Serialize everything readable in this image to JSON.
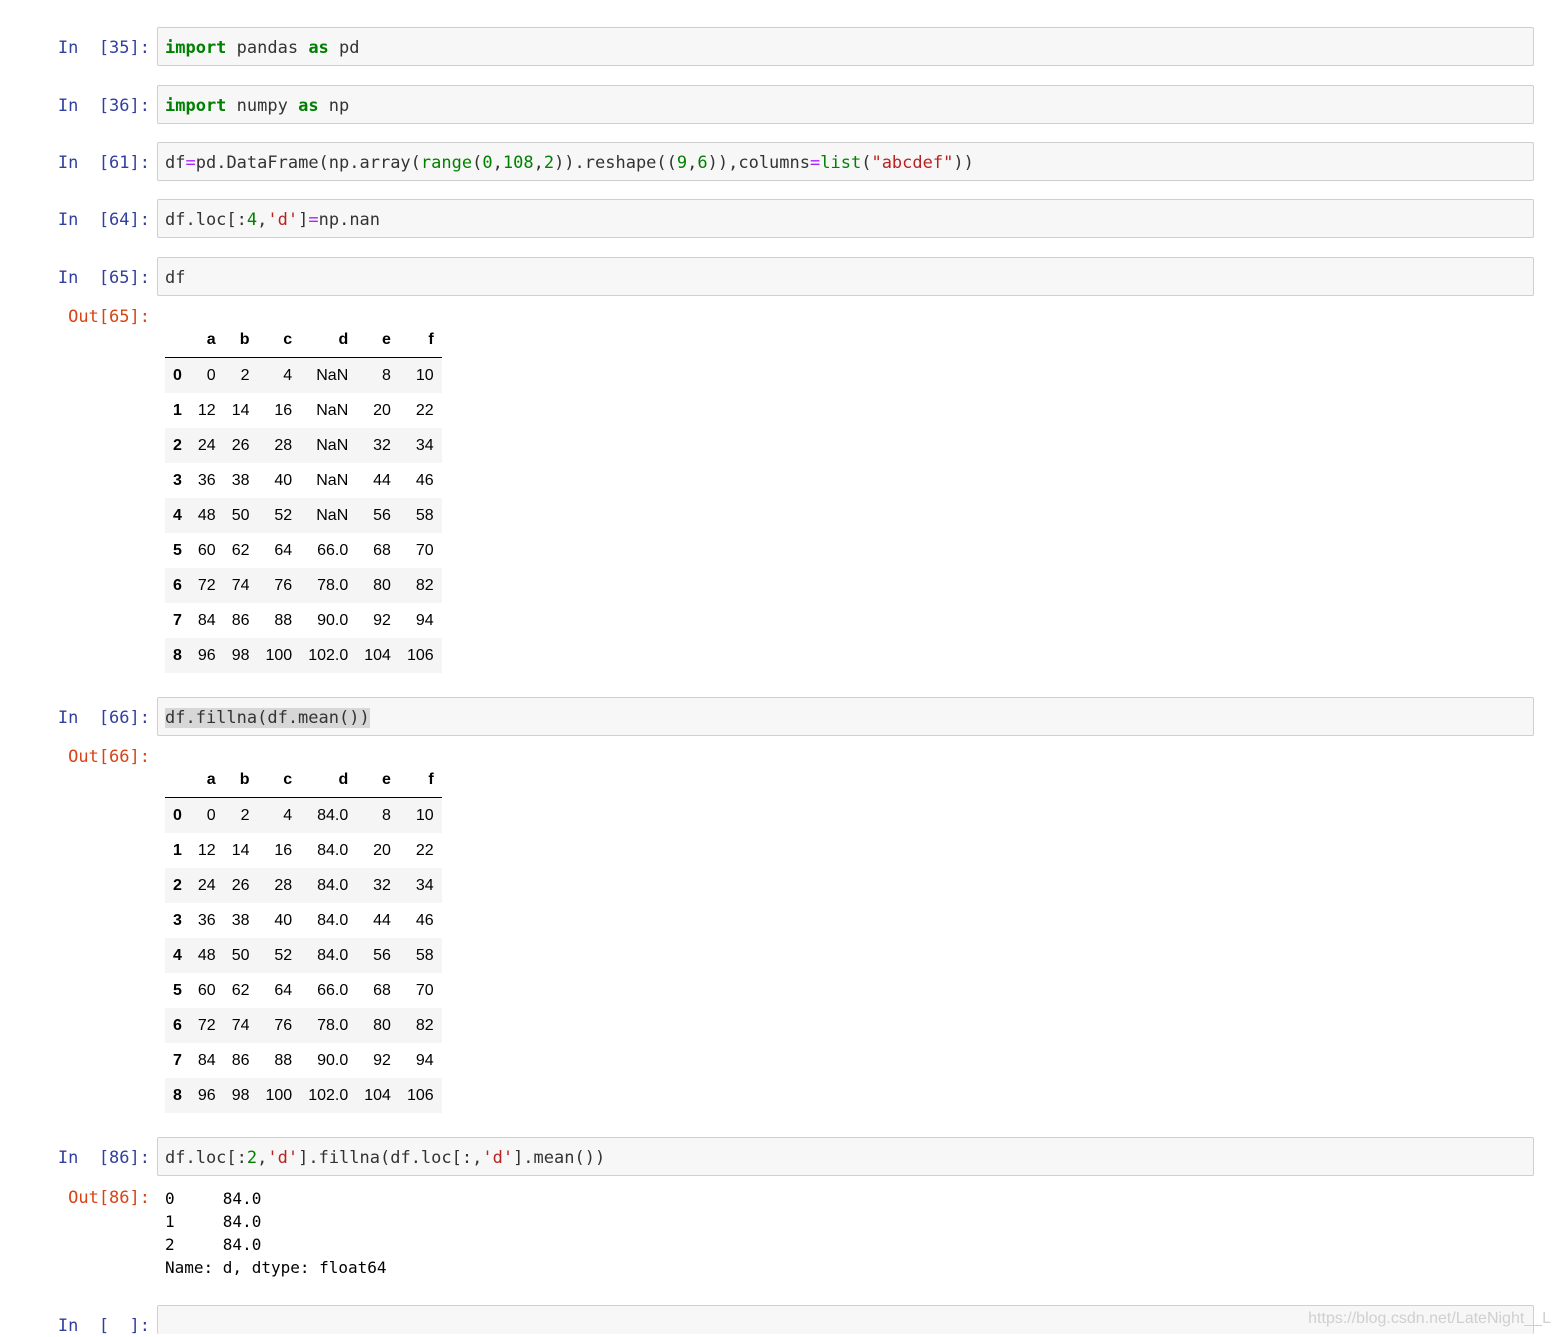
{
  "cells": [
    {
      "prompt": "In  [35]:",
      "code_tokens": [
        "import",
        " pandas ",
        "as",
        " pd"
      ]
    },
    {
      "prompt": "In  [36]:",
      "code_tokens": [
        "import",
        " numpy ",
        "as",
        " np"
      ]
    },
    {
      "prompt": "In  [61]:",
      "code_tokens": [
        "df",
        "=",
        "pd.DataFrame(np.array(",
        "range",
        "(",
        "0",
        ",",
        "108",
        ",",
        "2",
        ")).reshape((",
        "9",
        ",",
        "6",
        ")),columns",
        "=",
        "list",
        "(",
        "\"abcdef\"",
        "))"
      ]
    },
    {
      "prompt": "In  [64]:",
      "code_tokens": [
        "df.loc[:",
        "4",
        ",",
        "'d'",
        "]",
        "=",
        "np.nan"
      ]
    },
    {
      "prompt": "In  [65]:",
      "code_tokens": [
        "df"
      ],
      "out_prompt": "Out[65]:"
    },
    {
      "prompt": "In  [66]:",
      "code_tokens": [
        "df.fillna(df.mean())"
      ],
      "out_prompt": "Out[66]:"
    },
    {
      "prompt": "In  [86]:",
      "code_tokens": [
        "df.loc[:",
        "2",
        ",",
        "'d'",
        "].fillna(df.loc[:,",
        "'d'",
        "].mean())"
      ],
      "out_prompt": "Out[86]:"
    },
    {
      "prompt": "In  [  ]:",
      "code_tokens": []
    }
  ],
  "table_headers": [
    "",
    "a",
    "b",
    "c",
    "d",
    "e",
    "f"
  ],
  "table65": [
    [
      "0",
      "0",
      "2",
      "4",
      "NaN",
      "8",
      "10"
    ],
    [
      "1",
      "12",
      "14",
      "16",
      "NaN",
      "20",
      "22"
    ],
    [
      "2",
      "24",
      "26",
      "28",
      "NaN",
      "32",
      "34"
    ],
    [
      "3",
      "36",
      "38",
      "40",
      "NaN",
      "44",
      "46"
    ],
    [
      "4",
      "48",
      "50",
      "52",
      "NaN",
      "56",
      "58"
    ],
    [
      "5",
      "60",
      "62",
      "64",
      "66.0",
      "68",
      "70"
    ],
    [
      "6",
      "72",
      "74",
      "76",
      "78.0",
      "80",
      "82"
    ],
    [
      "7",
      "84",
      "86",
      "88",
      "90.0",
      "92",
      "94"
    ],
    [
      "8",
      "96",
      "98",
      "100",
      "102.0",
      "104",
      "106"
    ]
  ],
  "table66": [
    [
      "0",
      "0",
      "2",
      "4",
      "84.0",
      "8",
      "10"
    ],
    [
      "1",
      "12",
      "14",
      "16",
      "84.0",
      "20",
      "22"
    ],
    [
      "2",
      "24",
      "26",
      "28",
      "84.0",
      "32",
      "34"
    ],
    [
      "3",
      "36",
      "38",
      "40",
      "84.0",
      "44",
      "46"
    ],
    [
      "4",
      "48",
      "50",
      "52",
      "84.0",
      "56",
      "58"
    ],
    [
      "5",
      "60",
      "62",
      "64",
      "66.0",
      "68",
      "70"
    ],
    [
      "6",
      "72",
      "74",
      "76",
      "78.0",
      "80",
      "82"
    ],
    [
      "7",
      "84",
      "86",
      "88",
      "90.0",
      "92",
      "94"
    ],
    [
      "8",
      "96",
      "98",
      "100",
      "102.0",
      "104",
      "106"
    ]
  ],
  "series86": [
    "0     84.0",
    "1     84.0",
    "2     84.0",
    "Name: d, dtype: float64"
  ],
  "watermark": "https://blog.csdn.net/LateNight__L"
}
